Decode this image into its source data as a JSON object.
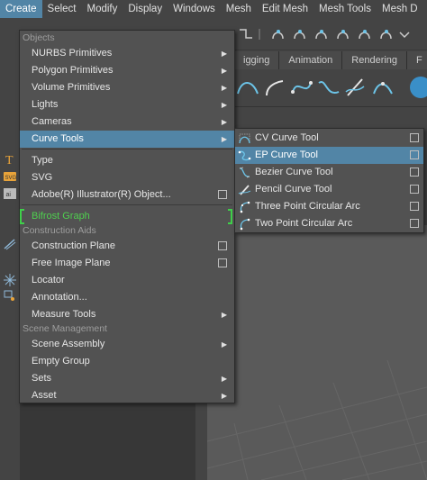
{
  "menubar": {
    "items": [
      "Create",
      "Select",
      "Modify",
      "Display",
      "Windows",
      "Mesh",
      "Edit Mesh",
      "Mesh Tools",
      "Mesh D"
    ]
  },
  "shelf": {
    "tabs": [
      "igging",
      "Animation",
      "Rendering",
      "F"
    ]
  },
  "create_menu": {
    "sections": {
      "objects": "Objects",
      "construction_aids": "Construction Aids",
      "scene_management": "Scene Management"
    },
    "items": {
      "nurbs_primitives": "NURBS Primitives",
      "polygon_primitives": "Polygon Primitives",
      "volume_primitives": "Volume Primitives",
      "lights": "Lights",
      "cameras": "Cameras",
      "curve_tools": "Curve Tools",
      "type": "Type",
      "svg": "SVG",
      "illustrator": "Adobe(R) Illustrator(R) Object...",
      "bifrost_graph": "Bifrost Graph",
      "construction_plane": "Construction Plane",
      "free_image_plane": "Free Image Plane",
      "locator": "Locator",
      "annotation": "Annotation...",
      "measure_tools": "Measure Tools",
      "scene_assembly": "Scene Assembly",
      "empty_group": "Empty Group",
      "sets": "Sets",
      "asset": "Asset"
    }
  },
  "curve_tools_submenu": {
    "items": {
      "cv_curve": "CV Curve Tool",
      "ep_curve": "EP Curve Tool",
      "bezier_curve": "Bezier Curve Tool",
      "pencil_curve": "Pencil Curve Tool",
      "three_point_arc": "Three Point Circular Arc",
      "two_point_arc": "Two Point Circular Arc"
    }
  },
  "colors": {
    "highlight": "#5285a6",
    "menu_bg": "#525252",
    "bifrost": "#4fcf4f",
    "icon_accent": "#6cc4e8"
  },
  "icons": [
    "cv-curve-icon",
    "ep-curve-icon",
    "bezier-curve-icon",
    "pencil-curve-icon",
    "three-point-arc-icon",
    "two-point-arc-icon",
    "type-icon",
    "svg-icon",
    "illustrator-icon",
    "measure-icon",
    "locator-icon"
  ]
}
